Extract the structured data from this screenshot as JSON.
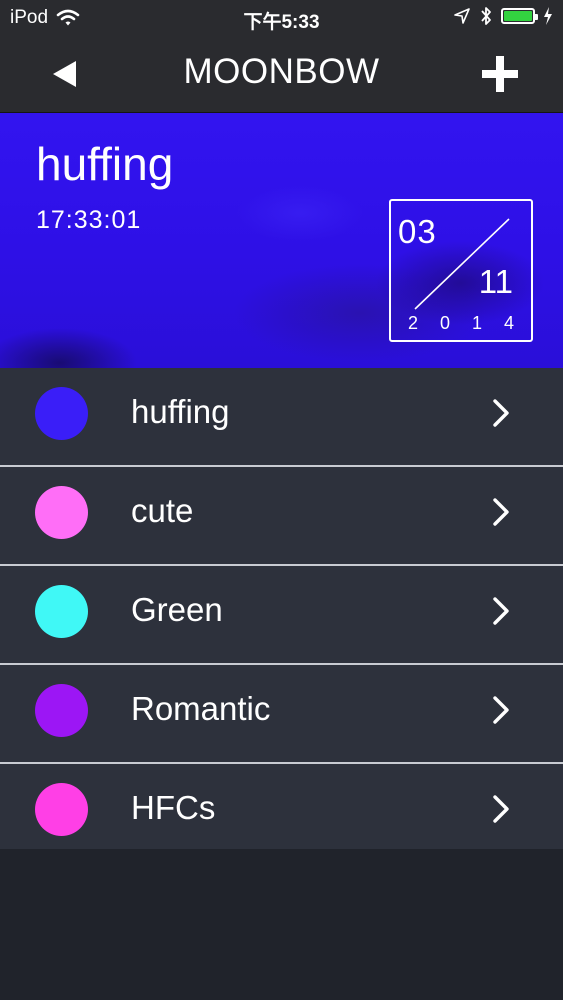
{
  "status_bar": {
    "carrier": "iPod",
    "time": "下午5:33",
    "battery_level": 1.0,
    "icons": [
      "wifi-icon",
      "location-arrow-icon",
      "bluetooth-icon",
      "battery-icon",
      "charging-bolt-icon"
    ]
  },
  "nav": {
    "title": "MOONBOW",
    "back_icon": "back-triangle-icon",
    "add_icon": "plus-icon"
  },
  "banner": {
    "title": "huffing",
    "time": "17:33:01",
    "date": {
      "month": "03",
      "day": "11",
      "year_digits": [
        "2",
        "0",
        "1",
        "4"
      ]
    }
  },
  "list": {
    "items": [
      {
        "label": "huffing",
        "color": "#3a1ef8"
      },
      {
        "label": "cute",
        "color": "#ff6ef7"
      },
      {
        "label": "Green",
        "color": "#40f8f6"
      },
      {
        "label": "Romantic",
        "color": "#9c16f5"
      },
      {
        "label": "HFCs",
        "color": "#ff3fe6"
      }
    ]
  },
  "colors": {
    "nav_background": "#2a2b2f",
    "list_background": "#2d313c",
    "page_background": "#20232b",
    "banner_color": "#3214f0"
  }
}
